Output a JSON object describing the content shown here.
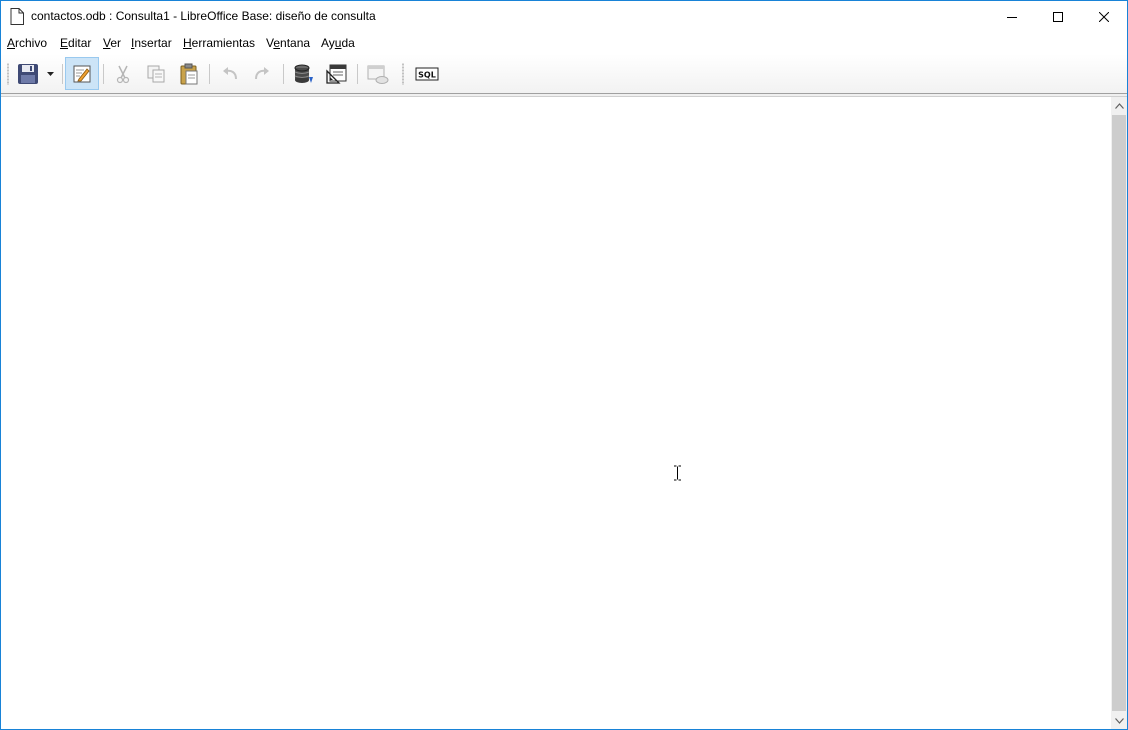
{
  "window": {
    "title": "contactos.odb : Consulta1 - LibreOffice Base: diseño de consulta",
    "buttons": {
      "minimize": "minimize-icon",
      "maximize": "maximize-icon",
      "close": "close-icon"
    }
  },
  "menubar": {
    "items": [
      {
        "label": "Archivo",
        "mnemonic": "A",
        "rest": "rchivo"
      },
      {
        "label": "Editar",
        "mnemonic": "E",
        "rest": "ditar"
      },
      {
        "label": "Ver",
        "mnemonic": "V",
        "rest": "er"
      },
      {
        "label": "Insertar",
        "mnemonic": "I",
        "rest": "nsertar"
      },
      {
        "label": "Herramientas",
        "mnemonic": "H",
        "rest": "erramientas"
      },
      {
        "label": "Ventana",
        "pre": "V",
        "mnemonic": "e",
        "rest": "ntana"
      },
      {
        "label": "Ayuda",
        "pre": "Ay",
        "mnemonic": "u",
        "rest": "da"
      }
    ]
  },
  "toolbar": {
    "buttons": [
      {
        "icon": "save-icon",
        "enabled": true
      },
      {
        "icon": "dropdown-arrow-icon",
        "enabled": true
      },
      {
        "icon": "edit-mode-icon",
        "enabled": true,
        "active": true
      },
      {
        "icon": "cut-icon",
        "enabled": false
      },
      {
        "icon": "copy-icon",
        "enabled": false
      },
      {
        "icon": "paste-icon",
        "enabled": true
      },
      {
        "icon": "undo-icon",
        "enabled": false
      },
      {
        "icon": "redo-icon",
        "enabled": false
      },
      {
        "icon": "run-query-icon",
        "enabled": true
      },
      {
        "icon": "design-view-icon",
        "enabled": true
      },
      {
        "icon": "add-table-icon",
        "enabled": false
      },
      {
        "icon": "sql-icon",
        "label": "SQL",
        "enabled": true
      }
    ]
  },
  "colors": {
    "window_border": "#1883d7",
    "active_button_bg": "#cce4f7",
    "scrollbar_thumb": "#cdcdcd"
  }
}
